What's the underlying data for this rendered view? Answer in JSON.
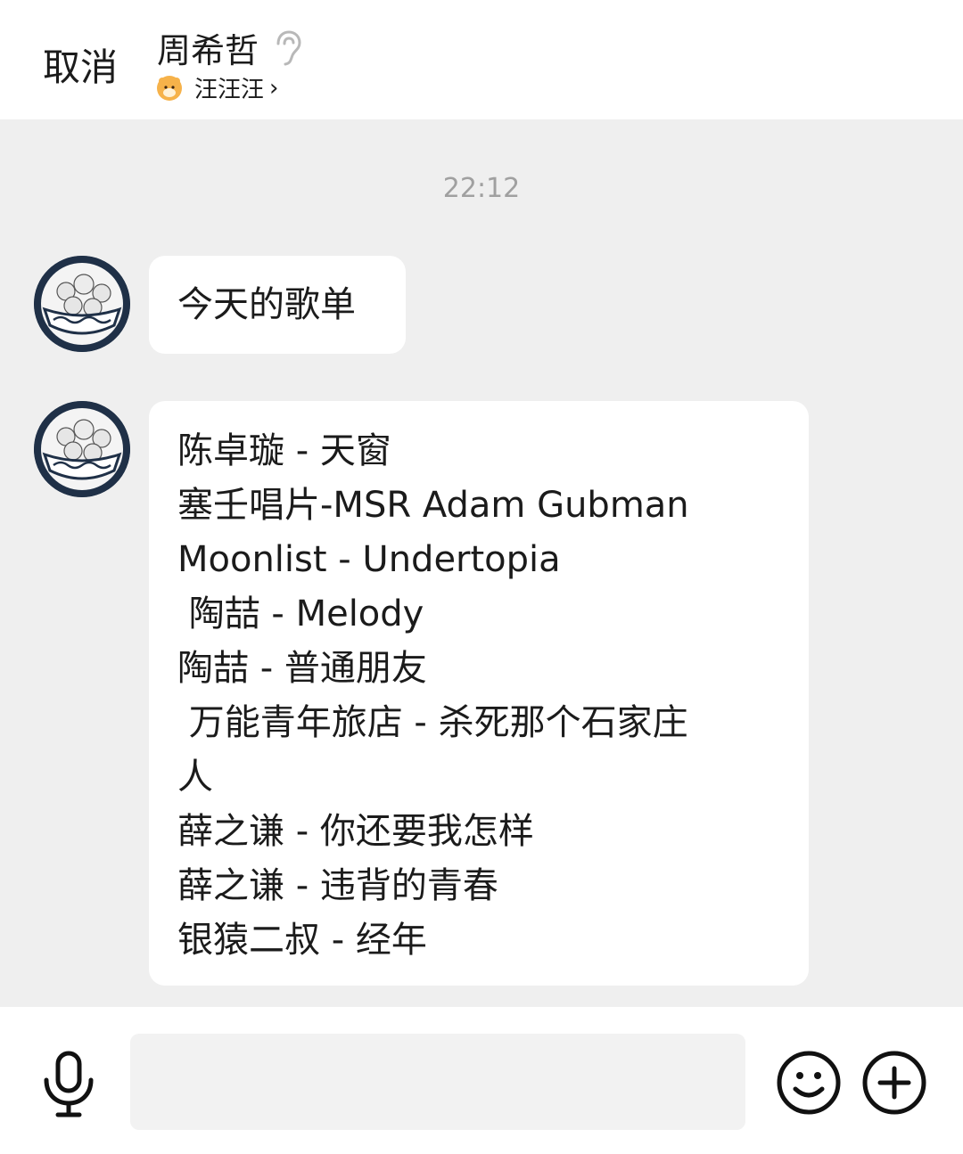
{
  "header": {
    "cancel_label": "取消",
    "contact_name": "周希哲",
    "group_name": "汪汪汪",
    "chevron": "›",
    "ear_icon": "ear-icon",
    "hamster_icon": "hamster-avatar-icon"
  },
  "chat": {
    "timestamp": "22:12",
    "messages": [
      {
        "text": "今天的歌单"
      },
      {
        "lines": [
          "陈卓璇 - 天窗",
          "塞壬唱片-MSR Adam Gubman",
          "Moonlist - Undertopia",
          " 陶喆 - Melody",
          "陶喆 - 普通朋友",
          " 万能青年旅店 - 杀死那个石家庄",
          "人",
          "薛之谦 - 你还要我怎样",
          "薛之谦 - 违背的青春",
          "银猿二叔 - 经年"
        ]
      }
    ]
  },
  "footer": {
    "input_placeholder": "",
    "mic_icon": "microphone-icon",
    "emoji_icon": "emoji-smile-icon",
    "plus_icon": "plus-circle-icon"
  },
  "colors": {
    "background": "#efefef",
    "bubble": "#ffffff",
    "avatar": "#1f3047",
    "timestamp": "#a0a0a0"
  }
}
